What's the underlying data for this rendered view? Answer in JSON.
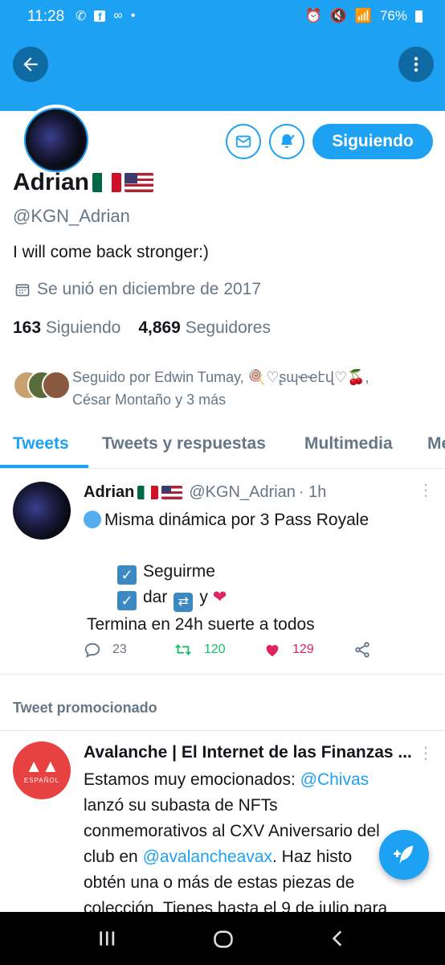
{
  "status": {
    "time": "11:28",
    "battery": "76%"
  },
  "profile": {
    "name": "Adrian",
    "handle": "@KGN_Adrian",
    "bio": "I will come back stronger:)",
    "joined": "Se unió en diciembre de 2017",
    "following_count": "163",
    "following_label": "Siguiendo",
    "followers_count": "4,869",
    "followers_label": "Seguidores",
    "follow_button": "Siguiendo",
    "followed_by_line1": "Seguido por Edwin Tumay, 🍭♡ʂɰҽҽէվ♡🍒,",
    "followed_by_line2": "César Montaño y 3 más"
  },
  "tabs": [
    "Tweets",
    "Tweets y respuestas",
    "Multimedia",
    "Me"
  ],
  "tweet": {
    "name": "Adrian",
    "handle": "@KGN_Adrian",
    "time": "· 1h",
    "line1": "Misma dinámica por 3 Pass Royale",
    "item1": "Seguirme",
    "item2_a": "dar",
    "item2_b": "y",
    "line_end": "Termina en 24h suerte a todos",
    "replies": "23",
    "retweets": "120",
    "likes": "129"
  },
  "promo": {
    "label": "Tweet promocionado",
    "name": "Avalanche | El Internet de las Finanzas ...",
    "avatar_text": "ESPAÑOL",
    "t1": "Estamos muy emocionados: ",
    "mention1": "@Chivas",
    "t2": "lanzó su subasta de NFTs",
    "t3": "conmemorativos al CXV Aniversario del",
    "t4": "club en ",
    "mention2": "@avalancheavax",
    "t5": ". Haz histo",
    "t6": "obtén una o más de estas piezas de",
    "t7": "colección.  Tienes hasta el 9 de julio para"
  },
  "colors": {
    "accent": "#1da1f2",
    "like": "#e0245e",
    "retweet": "#17bf63",
    "avalanche": "#e84142"
  }
}
